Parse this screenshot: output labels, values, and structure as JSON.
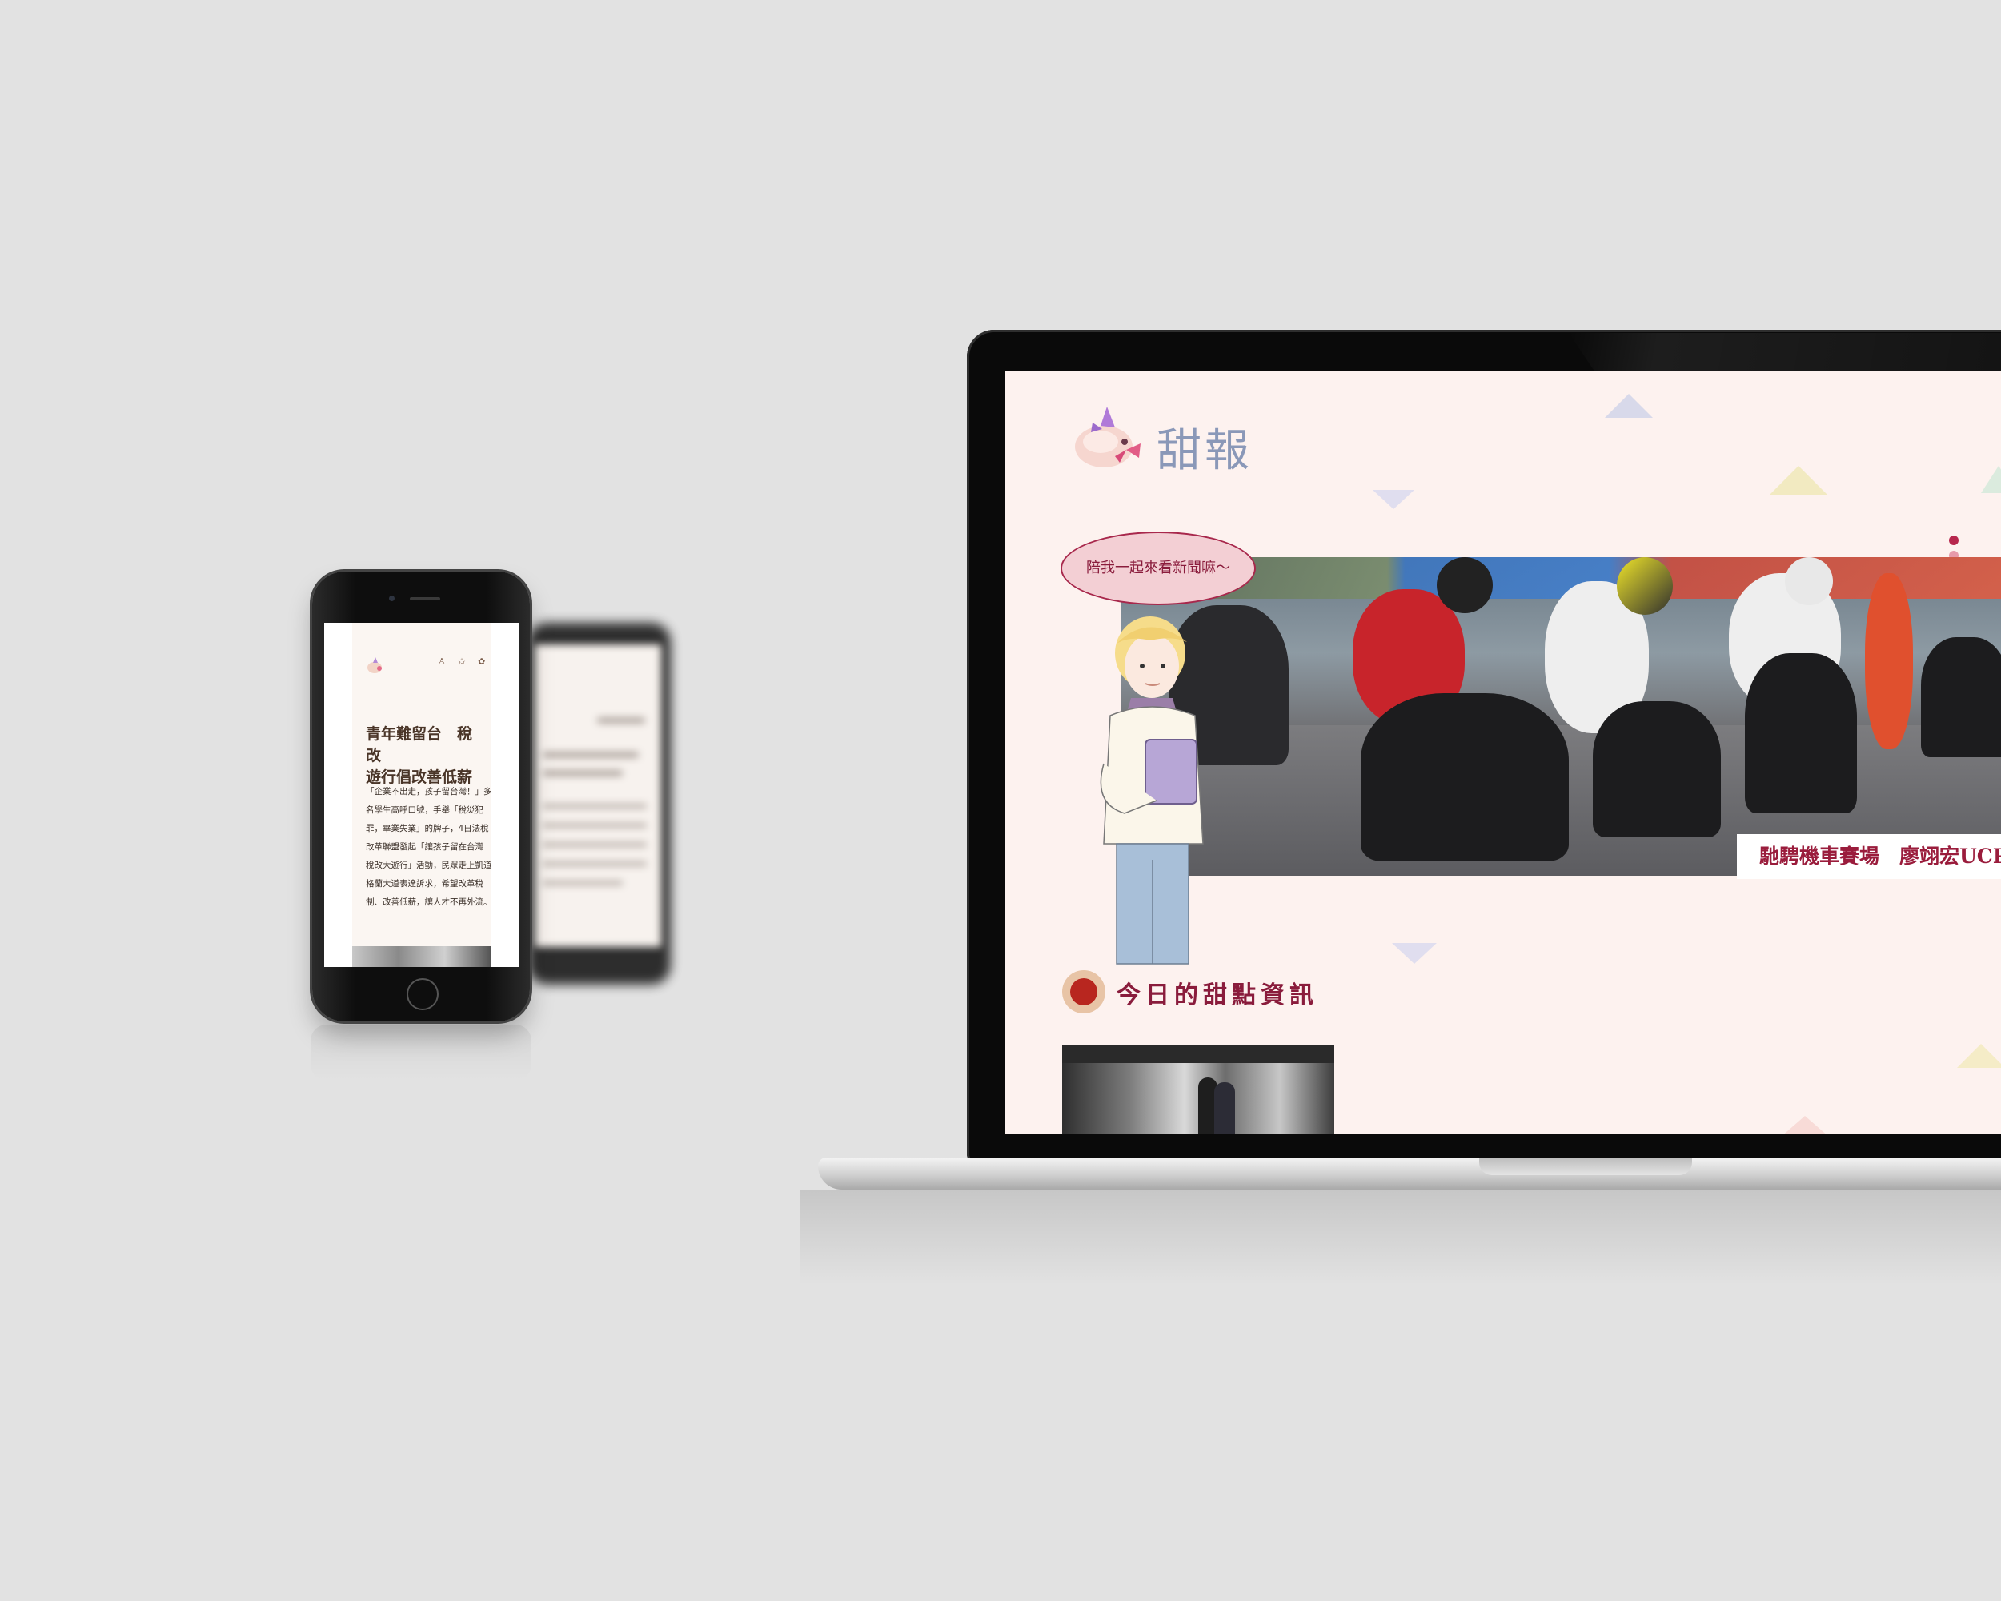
{
  "phone": {
    "top_icons": "♙ ✩ ✿",
    "headline": "青年難留台　稅改\n遊行倡改善低薪",
    "body": "「企業不出走，孩子留台灣！」多名學生高呼口號，手舉「稅災犯罪，畢業失業」的牌子，4日法稅改革聯盟發起「讓孩子留在台灣 稅改大遊行」活動，民眾走上凱道格蘭大道表達訴求，希望改革稅制、改善低薪，讓人才不再外流。"
  },
  "website": {
    "brand": "甜報",
    "speech_bubble": "陪我一起來看新聞嘛～",
    "hero_caption": "馳騁機車賽場　廖翊宏UCRR奪",
    "section_title": "今日的甜點資訊",
    "carousel_dots": 2,
    "carousel_active_index": 0
  },
  "colors": {
    "page_bg": "#fdf2ef",
    "accent": "#9a1c3c",
    "brand_text": "#8a98b8",
    "bubble_bg": "#f3cfd4"
  },
  "icons": {
    "logo": "unicorn-pig-mascot-icon",
    "section": "cookie-icon"
  }
}
